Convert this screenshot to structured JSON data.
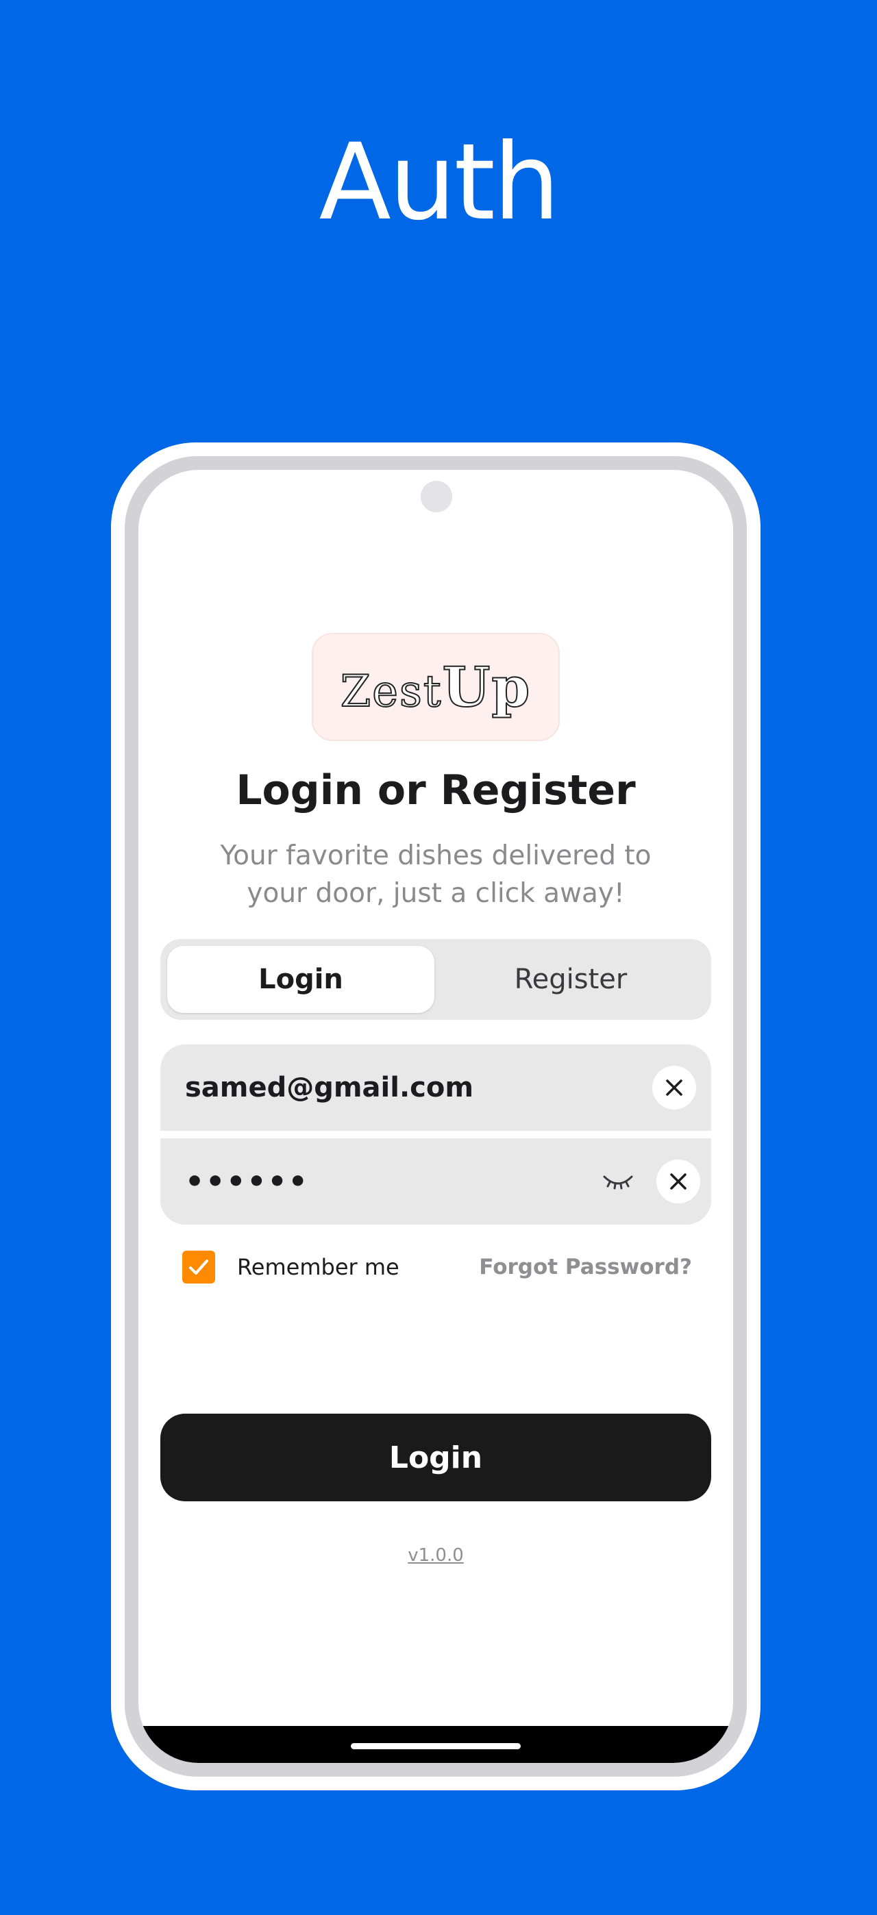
{
  "headline": "Auth",
  "app": {
    "logo": {
      "prefix": "Zest",
      "suffix": "Up"
    },
    "title": "Login or Register",
    "subtitle": "Your favorite dishes delivered to your door, just a click away!",
    "tabs": [
      {
        "label": "Login",
        "active": true
      },
      {
        "label": "Register",
        "active": false
      }
    ],
    "email": {
      "value": "samed@gmail.com",
      "clear_icon": "close-icon"
    },
    "password": {
      "value": "••••••",
      "visibility_icon": "eye-closed-icon",
      "clear_icon": "close-icon"
    },
    "remember": {
      "label": "Remember me",
      "checked": true
    },
    "forgot_label": "Forgot Password?",
    "submit_label": "Login",
    "version": "v1.0.0"
  },
  "colors": {
    "background": "#0068e6",
    "accent": "#ff8a00",
    "primary_button": "#1a1a1a",
    "logo_bg": "#fdf0ee"
  }
}
